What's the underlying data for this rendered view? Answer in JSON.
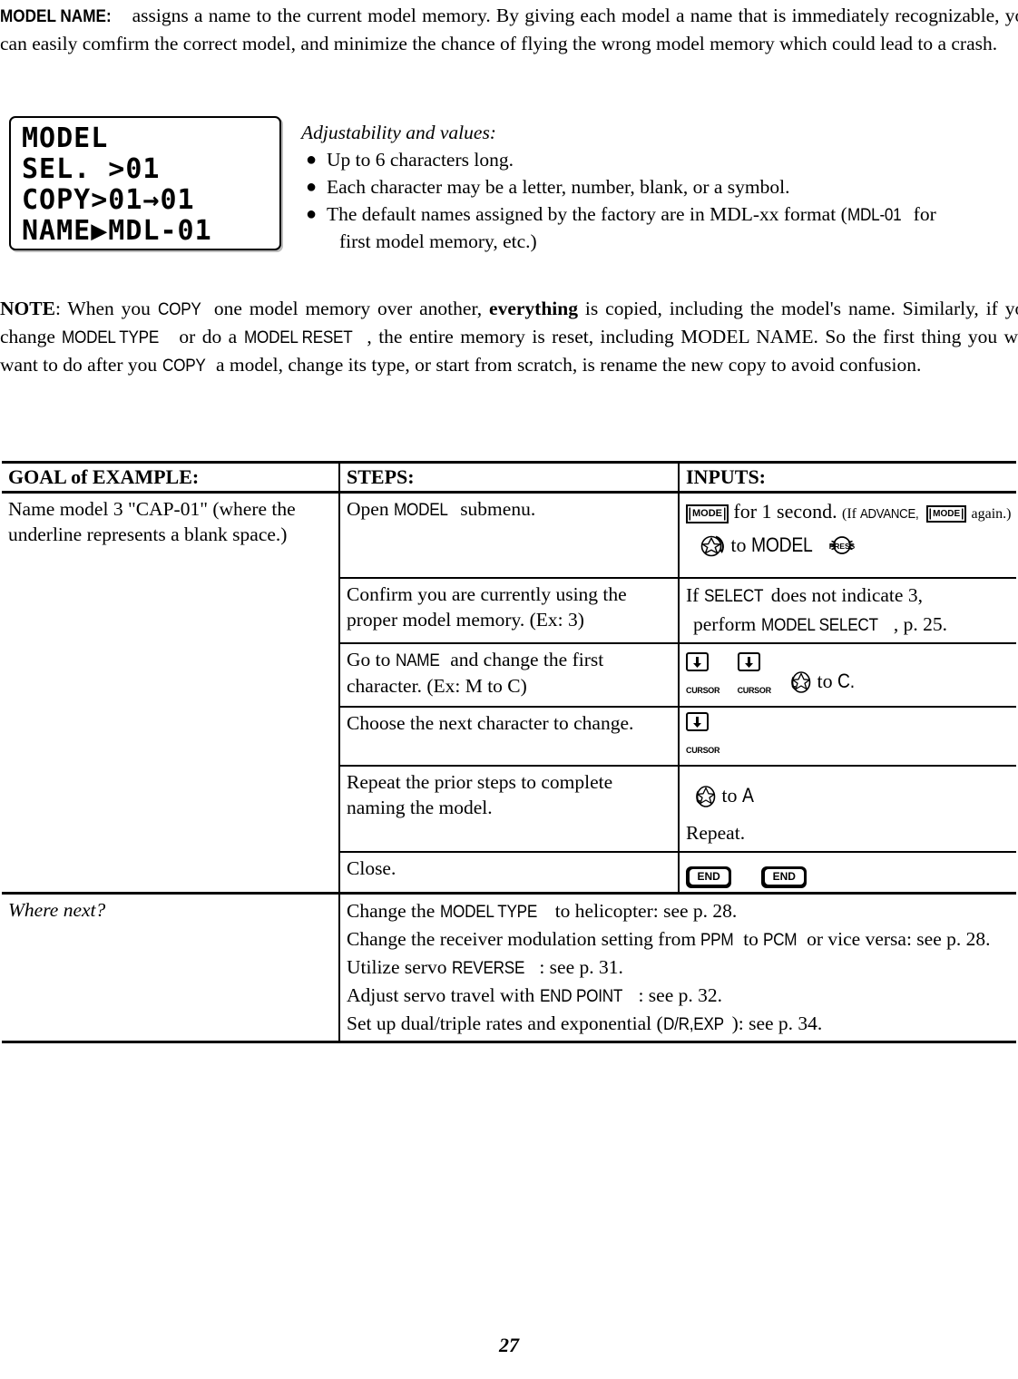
{
  "intro": {
    "lead": "MODEL NAME:",
    "body": " assigns a name to the current model memory. By giving each model a name that is immediately recognizable, you can easily comfirm the correct model, and minimize the chance of flying the wrong model memory which could lead to a crash."
  },
  "lcd": {
    "line1": "MODEL",
    "line2": "SEL. >01",
    "line3": "COPY>01→01",
    "line4": "NAME▶MDL-01"
  },
  "adjustability": {
    "title": "Adjustability and values:",
    "bullet_glyph": "●",
    "items": [
      "Up to 6 characters long.",
      "Each character may be a letter, number, blank, or a symbol.",
      "The default names assigned by the factory are in MDL-xx format (MDL-01  for first model memory, etc.)"
    ],
    "item3_pre": "The default names assigned by the factory are in MDL-xx format (",
    "item3_code": "MDL-01",
    "item3_post": "  for",
    "item3_line2": "first model memory, etc.)"
  },
  "note": {
    "label": "NOTE",
    "text_a": ": When you ",
    "copy1": "COPY",
    "text_b": " one model memory over another, ",
    "bold_everything": "everything",
    "text_c": " is copied, including the model's name. Similarly, if you change ",
    "model_type": "MODEL TYPE",
    "text_d": " or do a ",
    "model_reset": "MODEL RESET",
    "text_e": ", the entire memory is reset, including MODEL NAME. So the first thing you will want to do after you ",
    "copy2": "COPY",
    "text_f": " a model, change its type, or start from scratch, is rename the new copy to avoid confusion."
  },
  "table": {
    "headers": {
      "goal": "GOAL of EXAMPLE:",
      "steps": "STEPS:",
      "inputs": "INPUTS:"
    },
    "goal_text": "Name model 3 \"CAP-01\" (where the underline represents a blank space.)",
    "rows": [
      {
        "step_pre": "Open ",
        "step_code": "MODEL",
        "step_post": " submenu.",
        "input_line1": {
          "key": "MODE",
          "text1": "for 1 second.",
          "paren_open": "(If ",
          "advance": "ADVANCE,",
          "key2": "MODE",
          "paren_close": "again.)"
        },
        "input_line2": {
          "dial": "dial-icon",
          "text": "to ",
          "code": "MODEL",
          "press": "PRESS"
        }
      },
      {
        "step_text": "Confirm you are currently using the proper model memory. (Ex: 3)",
        "input_line1_pre": "If ",
        "input_line1_code": "SELECT",
        "input_line1_post": "does not indicate 3,",
        "input_line2_pre": "perform ",
        "input_line2_code": "MODEL SELECT",
        "input_line2_post": ", p. 25."
      },
      {
        "step_pre": "Go to ",
        "step_code": "NAME",
        "step_post": " and change the first character. (Ex: M to C)",
        "cursor_label": "CURSOR",
        "input_text": "to ",
        "input_code": "C."
      },
      {
        "step_text": "Choose the next character to change.",
        "cursor_label": "CURSOR"
      },
      {
        "step_text": "Repeat the prior steps to complete naming the model.",
        "input_line1_text": "to ",
        "input_line1_code": "A",
        "input_line2": "Repeat."
      },
      {
        "step_text": "Close.",
        "end_key": "END"
      }
    ],
    "where_next_label": "Where next?",
    "where_next": [
      {
        "pre": "Change the ",
        "code": "MODEL TYPE",
        "post": " to helicopter: see p. 28."
      },
      {
        "pre": "Change the receiver modulation setting from ",
        "code": "PPM",
        "mid": " to ",
        "code2": "PCM",
        "post": " or vice versa: see p. 28."
      },
      {
        "pre": "Utilize servo ",
        "code": "REVERSE",
        "post": " : see p. 31."
      },
      {
        "pre": "Adjust servo travel with ",
        "code": "END POINT",
        "post": " : see p. 32."
      },
      {
        "pre": "Set up dual/triple rates and exponential (",
        "code": "D/R,EXP",
        "post": "): see p. 34."
      }
    ]
  },
  "page_number": "27"
}
